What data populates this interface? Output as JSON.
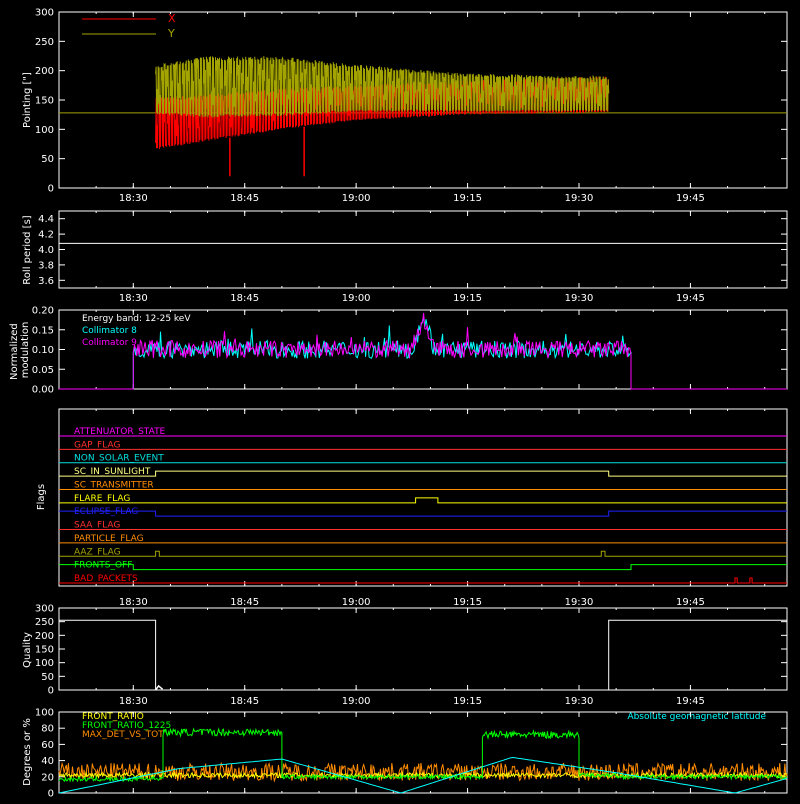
{
  "time_axis": {
    "ticks": [
      "18:30",
      "18:45",
      "19:00",
      "19:15",
      "19:30",
      "19:45"
    ],
    "range": [
      "18:20",
      "19:58"
    ]
  },
  "chart_data": [
    {
      "id": "pointing",
      "type": "line",
      "ylabel": "Pointing [\"]",
      "ylim": [
        0,
        300
      ],
      "yticks": [
        "0",
        "50",
        "100",
        "150",
        "200",
        "250",
        "300"
      ],
      "legend": [
        {
          "name": "X",
          "color": "#ff0000"
        },
        {
          "name": "Y",
          "color": "#a4a400"
        }
      ],
      "baseline": 128,
      "data_span": [
        "18:33",
        "19:34"
      ],
      "series": [
        {
          "name": "X",
          "color": "#ff0000",
          "envelope": {
            "t": [
              "18:33",
              "18:40",
              "18:50",
              "19:00",
              "19:15",
              "19:34"
            ],
            "low": [
              65,
              80,
              100,
              115,
              125,
              128
            ],
            "high": [
              155,
              160,
              170,
              175,
              185,
              190
            ]
          },
          "spikes": [
            {
              "t": "18:43",
              "value": 20
            },
            {
              "t": "18:53",
              "value": 20
            }
          ]
        },
        {
          "name": "Y",
          "color": "#a4a400",
          "envelope": {
            "t": [
              "18:33",
              "18:40",
              "18:50",
              "19:00",
              "19:15",
              "19:34"
            ],
            "low": [
              125,
              120,
              122,
              130,
              130,
              130
            ],
            "high": [
              210,
              225,
              225,
              210,
              195,
              190
            ]
          }
        }
      ]
    },
    {
      "id": "roll",
      "type": "line",
      "ylabel": "Roll period [s]",
      "ylim": [
        3.5,
        4.5
      ],
      "yticks": [
        "3.6",
        "3.8",
        "4.0",
        "4.2",
        "4.4"
      ],
      "series": [
        {
          "color": "#ffffff",
          "x": [
            "18:20",
            "19:58"
          ],
          "values": [
            4.08,
            4.08
          ]
        }
      ]
    },
    {
      "id": "modulation",
      "type": "line",
      "ylabel": "Normalized modulation",
      "ylim": [
        0,
        0.2
      ],
      "yticks": [
        "0.00",
        "0.05",
        "0.10",
        "0.15",
        "0.20"
      ],
      "annotation": "Energy band: 12-25 keV",
      "legend": [
        {
          "name": "Collimator 8",
          "color": "#00ffff"
        },
        {
          "name": "Collimator 9",
          "color": "#ff00ff"
        }
      ],
      "active_span": [
        "18:30",
        "19:37"
      ],
      "mean": 0.1,
      "peak": {
        "t": "19:09",
        "value": 0.2
      }
    },
    {
      "id": "flags",
      "type": "line",
      "ylabel": "Flags",
      "flags": [
        {
          "name": "ATTENUATOR_STATE",
          "color": "#ff00ff",
          "steps": []
        },
        {
          "name": "GAP_FLAG",
          "color": "#ff3030",
          "steps": []
        },
        {
          "name": "NON_SOLAR_EVENT",
          "color": "#00e0e0",
          "steps": []
        },
        {
          "name": "SC_IN_SUNLIGHT",
          "color": "#ffff80",
          "steps": [
            [
              "18:20",
              0
            ],
            [
              "18:33",
              1
            ],
            [
              "19:34",
              0
            ]
          ]
        },
        {
          "name": "SC_TRANSMITTER",
          "color": "#ff8c00",
          "steps": []
        },
        {
          "name": "FLARE_FLAG",
          "color": "#ffff00",
          "steps": [
            [
              "18:20",
              0
            ],
            [
              "19:08",
              1
            ],
            [
              "19:11",
              0
            ]
          ]
        },
        {
          "name": "ECLIPSE_FLAG",
          "color": "#2020ff",
          "steps": [
            [
              "18:20",
              1
            ],
            [
              "18:33",
              0
            ],
            [
              "19:34",
              1
            ]
          ]
        },
        {
          "name": "SAA_FLAG",
          "color": "#ff3030",
          "steps": []
        },
        {
          "name": "PARTICLE_FLAG",
          "color": "#ff8c00",
          "steps": []
        },
        {
          "name": "AAZ_FLAG",
          "color": "#a4a400",
          "steps": [
            [
              "18:20",
              0
            ],
            [
              "18:33",
              1
            ],
            [
              "18:33.5",
              0
            ],
            [
              "19:33",
              1
            ],
            [
              "19:33.5",
              0
            ]
          ]
        },
        {
          "name": "FRONTS_OFF",
          "color": "#00ff00",
          "steps": [
            [
              "18:20",
              1
            ],
            [
              "18:30",
              0
            ],
            [
              "19:37",
              1
            ]
          ]
        },
        {
          "name": "BAD_PACKETS",
          "color": "#ff0000",
          "steps": [
            [
              "18:20",
              0
            ],
            [
              "19:51",
              1
            ],
            [
              "19:51.3",
              0
            ],
            [
              "19:53",
              1
            ],
            [
              "19:53.3",
              0
            ]
          ]
        }
      ]
    },
    {
      "id": "quality",
      "type": "line",
      "ylabel": "Quality",
      "ylim": [
        0,
        300
      ],
      "yticks": [
        "0",
        "50",
        "100",
        "150",
        "200",
        "250",
        "300"
      ],
      "series": [
        {
          "color": "#ffffff",
          "steps": [
            [
              "18:20",
              255
            ],
            [
              "18:33",
              0
            ],
            [
              "19:34",
              255
            ]
          ]
        }
      ]
    },
    {
      "id": "latitude",
      "type": "line",
      "ylabel": "Degrees or %",
      "ylim": [
        0,
        100
      ],
      "yticks": [
        "0",
        "20",
        "40",
        "60",
        "80",
        "100"
      ],
      "legend_left": [
        {
          "name": "FRONT_RATIO",
          "color": "#ffff00"
        },
        {
          "name": "FRONT_RATIO_1225",
          "color": "#00ff00"
        },
        {
          "name": "MAX_DET_VS_TOT",
          "color": "#ff8c00"
        }
      ],
      "legend_right": {
        "name": "Absolute geomagnetic latitude",
        "color": "#00ffff"
      },
      "series": [
        {
          "name": "Absolute geomagnetic latitude",
          "color": "#00ffff",
          "x": [
            "18:20",
            "18:36",
            "18:50",
            "19:06",
            "19:21",
            "19:35",
            "19:51",
            "19:58"
          ],
          "values": [
            0,
            30,
            42,
            0,
            44,
            25,
            0,
            18
          ]
        },
        {
          "name": "FRONT_RATIO_1225",
          "color": "#00ff00",
          "plateaus": [
            {
              "from": "18:20",
              "to": "18:30",
              "level": 17
            },
            {
              "from": "18:30",
              "to": "18:34",
              "level": 18
            },
            {
              "from": "18:34",
              "to": "18:50",
              "level": 75
            },
            {
              "from": "18:50",
              "to": "19:17",
              "level": 20
            },
            {
              "from": "19:17",
              "to": "19:30",
              "level": 72
            },
            {
              "from": "19:30",
              "to": "19:35",
              "level": 22
            },
            {
              "from": "19:35",
              "to": "19:58",
              "level": 20
            }
          ]
        },
        {
          "name": "FRONT_RATIO",
          "color": "#ffff00",
          "level": 22
        },
        {
          "name": "MAX_DET_VS_TOT",
          "color": "#ff8c00",
          "level": 26
        }
      ]
    }
  ]
}
